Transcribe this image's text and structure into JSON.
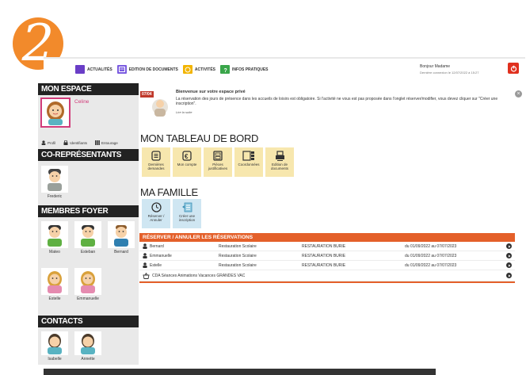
{
  "badge": "2",
  "nav": {
    "items": [
      {
        "label": "Actualités",
        "color": "#6a3ec7",
        "icon": "news-icon"
      },
      {
        "label": "Edition de documents",
        "color": "#7a5be0",
        "icon": "documents-icon"
      },
      {
        "label": "Activités",
        "color": "#f2b400",
        "icon": "activities-icon"
      },
      {
        "label": "Infos pratiques",
        "color": "#3aa64a",
        "icon": "info-icon"
      }
    ]
  },
  "user": {
    "greeting": "Bonjour Madame",
    "last_login": "Dernière connexion le 12/07/2022 à 15:27"
  },
  "sidebar": {
    "mon_espace": {
      "title": "MON ESPACE",
      "name": "Celine"
    },
    "actions": [
      {
        "label": "Profil",
        "icon": "profile-icon"
      },
      {
        "label": "Identifiants",
        "icon": "credentials-icon"
      },
      {
        "label": "Entourage",
        "icon": "entourage-icon"
      }
    ],
    "corep": {
      "title": "CO-REPRÉSENTANTS",
      "people": [
        {
          "name": "Frederic"
        }
      ]
    },
    "foyer": {
      "title": "MEMBRES FOYER",
      "people": [
        {
          "name": "Mateo"
        },
        {
          "name": "Esteban"
        },
        {
          "name": "Bernard"
        },
        {
          "name": "Estelle"
        },
        {
          "name": "Emmanuelle"
        }
      ]
    },
    "contacts": {
      "title": "CONTACTS",
      "people": [
        {
          "name": "Isabelle"
        },
        {
          "name": "Annette"
        }
      ]
    }
  },
  "welcome": {
    "date": "07/04",
    "title": "Bienvenue sur votre espace privé",
    "text": "La réservation des jours de présence dans les accueils de loisirs est obligatoire. Si l'activité ne vous est pas proposée dans l'onglet réserver/modifier, vous devez cliquer sur \"Créer une inscription\".",
    "more": "Lire la suite"
  },
  "dashboard": {
    "title": "MON TABLEAU DE BORD",
    "tiles": [
      {
        "label": "Dernières demandes",
        "icon": "requests-icon"
      },
      {
        "label": "Mon compte",
        "icon": "euro-icon"
      },
      {
        "label": "Pièces justificatives",
        "icon": "docs-icon"
      },
      {
        "label": "Coordonnées",
        "icon": "contact-card-icon"
      },
      {
        "label": "Edition de documents",
        "icon": "printer-icon"
      }
    ]
  },
  "famille": {
    "title": "MA FAMILLE",
    "tiles": [
      {
        "label": "Réserver / Annuler",
        "icon": "clock-icon"
      },
      {
        "label": "Créer une inscription",
        "icon": "form-icon"
      }
    ]
  },
  "reservations": {
    "title": "RÉSERVER / ANNULER LES RÉSERVATIONS",
    "rows": [
      {
        "name": "Bernard",
        "service": "Restauration Scolaire",
        "place": "RESTAURATION BURIE",
        "dates": "du 01/09/2022 au 07/07/2023"
      },
      {
        "name": "Emmanuelle",
        "service": "Restauration Scolaire",
        "place": "RESTAURATION BURIE",
        "dates": "du 01/09/2022 au 07/07/2023"
      },
      {
        "name": "Estelle",
        "service": "Restauration Scolaire",
        "place": "RESTAURATION BURIE",
        "dates": "du 01/09/2022 au 07/07/2023"
      }
    ],
    "cda": "CDA Séances Animations Vacances GRANDES VAC"
  }
}
